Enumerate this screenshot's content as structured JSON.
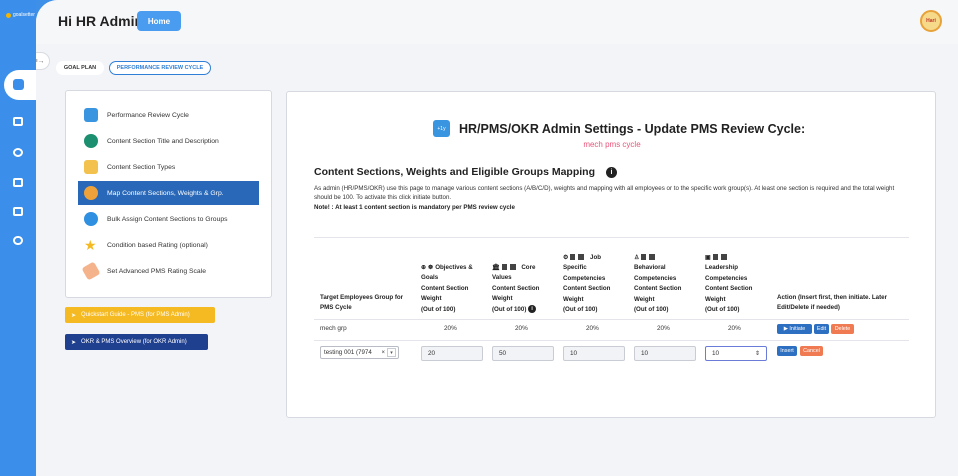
{
  "app": {
    "logo_text": "goalsetter",
    "greeting": "Hi HR Admin",
    "home_button": "Home",
    "avatar_text": "Hari"
  },
  "tabs": {
    "goal_plan": "GOAL PLAN",
    "performance_review_cycle": "PERFORMANCE REVIEW CYCLE"
  },
  "left_menu": {
    "items": [
      {
        "label": "Performance Review Cycle",
        "icon": "calendar-icon"
      },
      {
        "label": "Content Section Title and Description",
        "icon": "dots-icon"
      },
      {
        "label": "Content Section Types",
        "icon": "trophy-icon"
      },
      {
        "label": "Map Content Sections, Weights & Grp.",
        "icon": "people-icon"
      },
      {
        "label": "Bulk Assign Content Sections to Groups",
        "icon": "refresh-icon"
      },
      {
        "label": "Condition based Rating (optional)",
        "icon": "star-icon"
      },
      {
        "label": "Set Advanced PMS Rating Scale",
        "icon": "ruler-icon"
      }
    ],
    "active_index": 3
  },
  "quick_buttons": {
    "quickstart": "Quickstart Guide - PMS (for PMS Admin)",
    "overview": "OKR & PMS Overview (for OKR Admin)"
  },
  "main": {
    "title": "HR/PMS/OKR Admin Settings - Update PMS Review Cycle:",
    "cycle_name": "mech pms cycle",
    "section_heading": "Content Sections, Weights and Eligible Groups Mapping",
    "description": "As admin (HR/PMS/OKR) use this page to manage various content sections (A/B/C/D), weights and mapping with all employees or to the specific work group(s). At least one section is required and the total weight should be 100. To activate this click initiate button.",
    "note": "Note! : At least 1 content section is mandatory per PMS review cycle"
  },
  "table": {
    "headers": {
      "group": [
        "Target Employees Group for",
        "PMS Cycle"
      ],
      "col1": [
        "Objectives &",
        "Goals",
        "Content Section",
        "Weight",
        "(Out of 100)"
      ],
      "col2": [
        "Core",
        "Values",
        "Content Section",
        "Weight",
        "(Out of 100)"
      ],
      "col3": [
        "Job",
        "Specific",
        "Competencies",
        "Content Section",
        "Weight",
        "(Out of 100)"
      ],
      "col4": [
        "Behavioral",
        "Competencies",
        "Content Section",
        "Weight",
        "(Out of 100)"
      ],
      "col5": [
        "Leadership",
        "Competencies",
        "Content Section",
        "Weight",
        "(Out of 100)"
      ],
      "action": [
        "Action (Insert first, then initiate. Later",
        "Edit/Delete if needed)"
      ]
    },
    "rows": [
      {
        "group": "mech grp",
        "w1": "20%",
        "w2": "20%",
        "w3": "20%",
        "w4": "20%",
        "w5": "20%",
        "actions": [
          "Initiate",
          "Edit",
          "Delete"
        ]
      }
    ],
    "new_row": {
      "group_selected": "testing 001 (7974",
      "w1": "20",
      "w2": "50",
      "w3": "10",
      "w4": "10",
      "w5": "10",
      "actions": [
        "Insert",
        "Cancel"
      ]
    }
  },
  "colors": {
    "primary": "#3b8eea",
    "active_menu": "#2968b8",
    "accent_pink": "#e8557a",
    "yellow": "#f5b921",
    "navy": "#1f3f8f",
    "delete": "#f07a52"
  }
}
